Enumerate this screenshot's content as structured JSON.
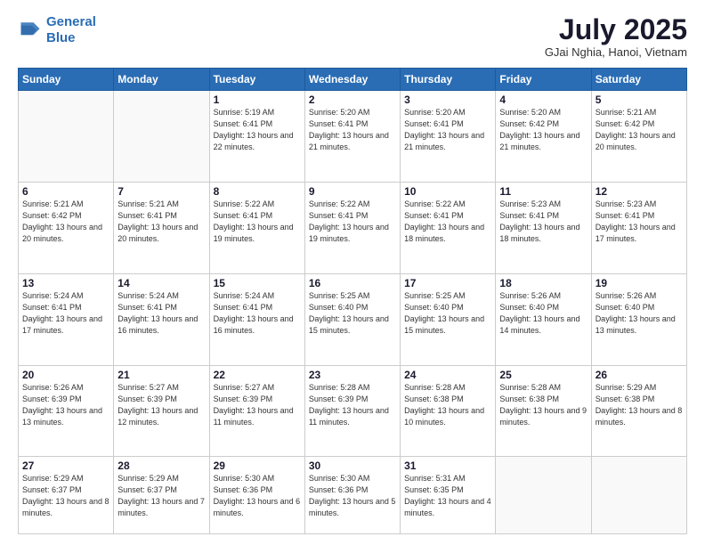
{
  "logo": {
    "line1": "General",
    "line2": "Blue"
  },
  "title": "July 2025",
  "subtitle": "GJai Nghia, Hanoi, Vietnam",
  "days_of_week": [
    "Sunday",
    "Monday",
    "Tuesday",
    "Wednesday",
    "Thursday",
    "Friday",
    "Saturday"
  ],
  "weeks": [
    [
      {
        "day": "",
        "info": ""
      },
      {
        "day": "",
        "info": ""
      },
      {
        "day": "1",
        "info": "Sunrise: 5:19 AM\nSunset: 6:41 PM\nDaylight: 13 hours and 22 minutes."
      },
      {
        "day": "2",
        "info": "Sunrise: 5:20 AM\nSunset: 6:41 PM\nDaylight: 13 hours and 21 minutes."
      },
      {
        "day": "3",
        "info": "Sunrise: 5:20 AM\nSunset: 6:41 PM\nDaylight: 13 hours and 21 minutes."
      },
      {
        "day": "4",
        "info": "Sunrise: 5:20 AM\nSunset: 6:42 PM\nDaylight: 13 hours and 21 minutes."
      },
      {
        "day": "5",
        "info": "Sunrise: 5:21 AM\nSunset: 6:42 PM\nDaylight: 13 hours and 20 minutes."
      }
    ],
    [
      {
        "day": "6",
        "info": "Sunrise: 5:21 AM\nSunset: 6:42 PM\nDaylight: 13 hours and 20 minutes."
      },
      {
        "day": "7",
        "info": "Sunrise: 5:21 AM\nSunset: 6:41 PM\nDaylight: 13 hours and 20 minutes."
      },
      {
        "day": "8",
        "info": "Sunrise: 5:22 AM\nSunset: 6:41 PM\nDaylight: 13 hours and 19 minutes."
      },
      {
        "day": "9",
        "info": "Sunrise: 5:22 AM\nSunset: 6:41 PM\nDaylight: 13 hours and 19 minutes."
      },
      {
        "day": "10",
        "info": "Sunrise: 5:22 AM\nSunset: 6:41 PM\nDaylight: 13 hours and 18 minutes."
      },
      {
        "day": "11",
        "info": "Sunrise: 5:23 AM\nSunset: 6:41 PM\nDaylight: 13 hours and 18 minutes."
      },
      {
        "day": "12",
        "info": "Sunrise: 5:23 AM\nSunset: 6:41 PM\nDaylight: 13 hours and 17 minutes."
      }
    ],
    [
      {
        "day": "13",
        "info": "Sunrise: 5:24 AM\nSunset: 6:41 PM\nDaylight: 13 hours and 17 minutes."
      },
      {
        "day": "14",
        "info": "Sunrise: 5:24 AM\nSunset: 6:41 PM\nDaylight: 13 hours and 16 minutes."
      },
      {
        "day": "15",
        "info": "Sunrise: 5:24 AM\nSunset: 6:41 PM\nDaylight: 13 hours and 16 minutes."
      },
      {
        "day": "16",
        "info": "Sunrise: 5:25 AM\nSunset: 6:40 PM\nDaylight: 13 hours and 15 minutes."
      },
      {
        "day": "17",
        "info": "Sunrise: 5:25 AM\nSunset: 6:40 PM\nDaylight: 13 hours and 15 minutes."
      },
      {
        "day": "18",
        "info": "Sunrise: 5:26 AM\nSunset: 6:40 PM\nDaylight: 13 hours and 14 minutes."
      },
      {
        "day": "19",
        "info": "Sunrise: 5:26 AM\nSunset: 6:40 PM\nDaylight: 13 hours and 13 minutes."
      }
    ],
    [
      {
        "day": "20",
        "info": "Sunrise: 5:26 AM\nSunset: 6:39 PM\nDaylight: 13 hours and 13 minutes."
      },
      {
        "day": "21",
        "info": "Sunrise: 5:27 AM\nSunset: 6:39 PM\nDaylight: 13 hours and 12 minutes."
      },
      {
        "day": "22",
        "info": "Sunrise: 5:27 AM\nSunset: 6:39 PM\nDaylight: 13 hours and 11 minutes."
      },
      {
        "day": "23",
        "info": "Sunrise: 5:28 AM\nSunset: 6:39 PM\nDaylight: 13 hours and 11 minutes."
      },
      {
        "day": "24",
        "info": "Sunrise: 5:28 AM\nSunset: 6:38 PM\nDaylight: 13 hours and 10 minutes."
      },
      {
        "day": "25",
        "info": "Sunrise: 5:28 AM\nSunset: 6:38 PM\nDaylight: 13 hours and 9 minutes."
      },
      {
        "day": "26",
        "info": "Sunrise: 5:29 AM\nSunset: 6:38 PM\nDaylight: 13 hours and 8 minutes."
      }
    ],
    [
      {
        "day": "27",
        "info": "Sunrise: 5:29 AM\nSunset: 6:37 PM\nDaylight: 13 hours and 8 minutes."
      },
      {
        "day": "28",
        "info": "Sunrise: 5:29 AM\nSunset: 6:37 PM\nDaylight: 13 hours and 7 minutes."
      },
      {
        "day": "29",
        "info": "Sunrise: 5:30 AM\nSunset: 6:36 PM\nDaylight: 13 hours and 6 minutes."
      },
      {
        "day": "30",
        "info": "Sunrise: 5:30 AM\nSunset: 6:36 PM\nDaylight: 13 hours and 5 minutes."
      },
      {
        "day": "31",
        "info": "Sunrise: 5:31 AM\nSunset: 6:35 PM\nDaylight: 13 hours and 4 minutes."
      },
      {
        "day": "",
        "info": ""
      },
      {
        "day": "",
        "info": ""
      }
    ]
  ]
}
